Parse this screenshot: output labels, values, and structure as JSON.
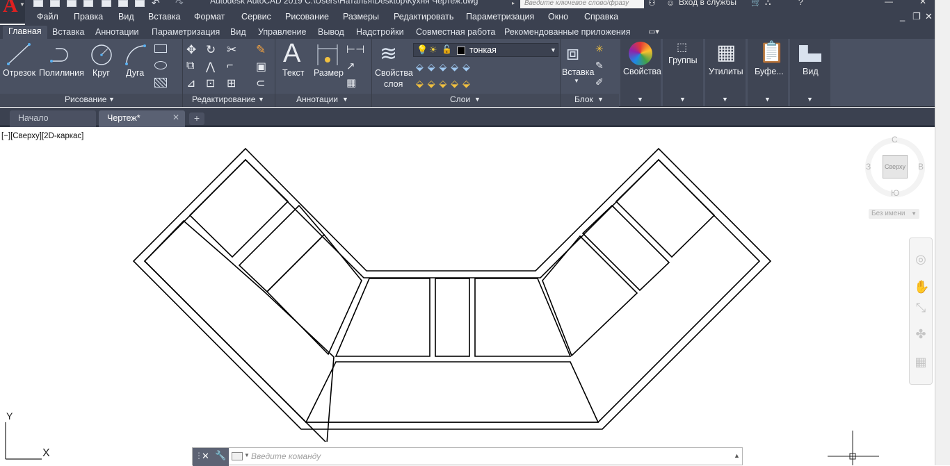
{
  "title_bar": {
    "title": "Autodesk AutoCAD 2019   C:\\Users\\Наталья\\Desktop\\Кухня Чертеж.dwg",
    "search_placeholder": "Введите ключевое слово/фразу",
    "login": "Вход в службы"
  },
  "menu": {
    "items": [
      "Файл",
      "Правка",
      "Вид",
      "Вставка",
      "Формат",
      "Сервис",
      "Рисование",
      "Размеры",
      "Редактировать",
      "Параметризация",
      "Окно",
      "Справка"
    ],
    "window_controls": [
      "_",
      "❐",
      "✕"
    ]
  },
  "ribbon_tabs": [
    "Главная",
    "Вставка",
    "Аннотации",
    "Параметризация",
    "Вид",
    "Управление",
    "Вывод",
    "Надстройки",
    "Совместная работа",
    "Рекомендованные приложения"
  ],
  "ribbon": {
    "draw": {
      "line": "Отрезок",
      "polyline": "Полилиния",
      "circle": "Круг",
      "arc": "Дуга",
      "panel": "Рисование"
    },
    "modify": {
      "panel": "Редактирование"
    },
    "annotation": {
      "text": "Текст",
      "dimension": "Размер",
      "panel": "Аннотации"
    },
    "layers": {
      "properties_line1": "Свойства",
      "properties_line2": "слоя",
      "current_layer": "тонкая",
      "panel": "Слои"
    },
    "block": {
      "insert": "Вставка",
      "panel": "Блок"
    },
    "properties": "Свойства",
    "groups": "Группы",
    "utilities": "Утилиты",
    "clipboard": "Буфе...",
    "view": "Вид"
  },
  "file_tabs": [
    {
      "label": "Начало",
      "active": false
    },
    {
      "label": "Чертеж*",
      "active": true
    }
  ],
  "viewport": {
    "label": "[−][Сверху][2D-каркас]"
  },
  "viewcube": {
    "north": "С",
    "south": "Ю",
    "west": "З",
    "east": "В",
    "face": "Сверху",
    "ucs_menu": "Без имени"
  },
  "ucs": {
    "x": "X",
    "y": "Y"
  },
  "command_line": {
    "placeholder": "Введите  команду"
  },
  "colors": {
    "chrome_dark": "#3b4150",
    "ribbon": "#4a5162",
    "canvas": "#ffffff",
    "logo_red": "#e02020"
  }
}
